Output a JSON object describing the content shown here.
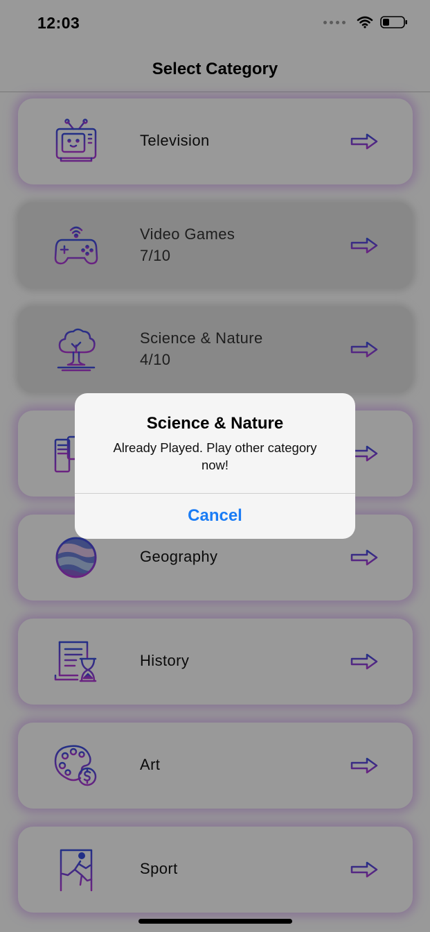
{
  "status_bar": {
    "time": "12:03"
  },
  "nav": {
    "title": "Select Category"
  },
  "categories": [
    {
      "label": "Television",
      "score": "",
      "icon": "television-icon",
      "played": false
    },
    {
      "label": "Video Games",
      "score": "7/10",
      "icon": "gamepad-icon",
      "played": true
    },
    {
      "label": "Science & Nature",
      "score": "4/10",
      "icon": "tree-icon",
      "played": true
    },
    {
      "label": "",
      "score": "",
      "icon": "computer-icon",
      "played": false
    },
    {
      "label": "Geography",
      "score": "",
      "icon": "globe-icon",
      "played": false
    },
    {
      "label": "History",
      "score": "",
      "icon": "history-icon",
      "played": false
    },
    {
      "label": "Art",
      "score": "",
      "icon": "palette-icon",
      "played": false
    },
    {
      "label": "Sport",
      "score": "",
      "icon": "runner-icon",
      "played": false
    }
  ],
  "alert": {
    "title": "Science & Nature",
    "message": "Already Played. Play other category now!",
    "cancel_label": "Cancel"
  },
  "colors": {
    "accent_purple": "#8a35e0",
    "accent_blue": "#3a4fe0",
    "alert_button": "#1a7cf5"
  }
}
